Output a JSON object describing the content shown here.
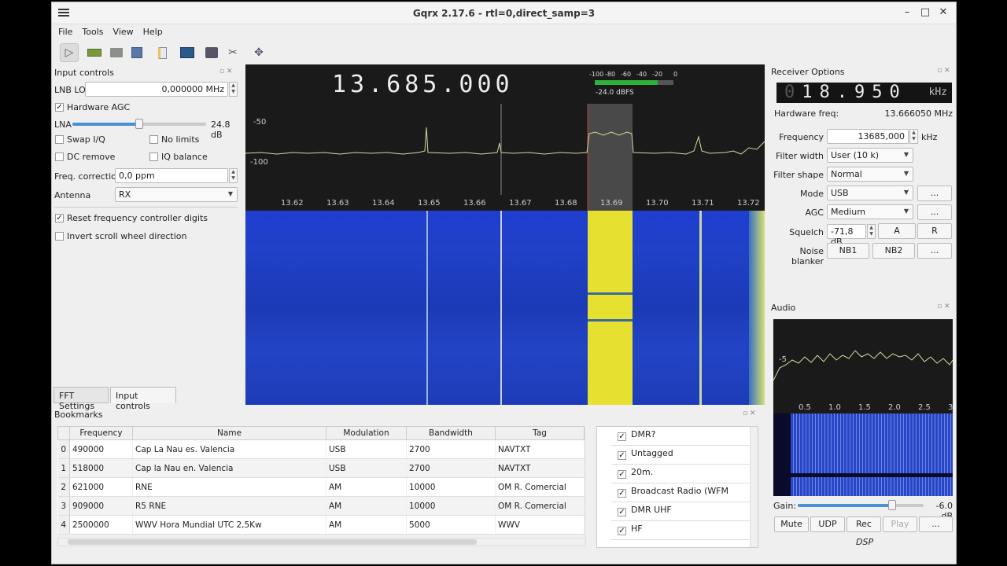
{
  "window": {
    "title": "Gqrx 2.17.6 - rtl=0,direct_samp=3",
    "minimize": "–",
    "maximize": "□",
    "close": "✕"
  },
  "menu": [
    "File",
    "Tools",
    "View",
    "Help"
  ],
  "toolbar": {
    "icons": [
      "play-icon",
      "hardware-icon",
      "open-icon",
      "save-icon",
      "document-icon",
      "spectrum-icon",
      "remote-icon",
      "tools-icon",
      "move-icon"
    ]
  },
  "input_controls": {
    "title": "Input controls",
    "lnb_lo_label": "LNB LO",
    "lnb_lo_value": "0,000000 MHz",
    "hardware_agc_label": "Hardware AGC",
    "lna_label": "LNA",
    "lna_value": "24.8 dB",
    "lna_level": 0.5,
    "swap_iq": "Swap I/Q",
    "no_limits": "No limits",
    "dc_remove": "DC remove",
    "iq_balance": "IQ balance",
    "freq_corr_label": "Freq. correction",
    "freq_corr_value": "0,0 ppm",
    "antenna_label": "Antenna",
    "antenna_value": "RX",
    "reset_digits": "Reset frequency controller digits",
    "invert_scroll": "Invert scroll wheel direction"
  },
  "left_tabs": [
    "FFT Settings",
    "Input controls"
  ],
  "display": {
    "frequency": "13.685.000",
    "meter_ticks": [
      "-100",
      "-80",
      "-60",
      "-40",
      "-20",
      "0"
    ],
    "meter_value": "-24.0 dBFS",
    "y_ticks": [
      "-50",
      "-100"
    ],
    "x_ticks": [
      "13.62",
      "13.63",
      "13.64",
      "13.65",
      "13.66",
      "13.67",
      "13.68",
      "13.69",
      "13.70",
      "13.71",
      "13.72"
    ]
  },
  "receiver": {
    "title": "Receiver Options",
    "lcd_dim": "0",
    "lcd_value": "18.950",
    "lcd_unit": "kHz",
    "hw_freq_label": "Hardware freq:",
    "hw_freq_value": "13.666050 MHz",
    "frequency_label": "Frequency",
    "frequency_value": "13685,000",
    "frequency_unit": "kHz",
    "filter_width_label": "Filter width",
    "filter_width_value": "User (10 k)",
    "filter_shape_label": "Filter shape",
    "filter_shape_value": "Normal",
    "mode_label": "Mode",
    "mode_value": "USB",
    "agc_label": "AGC",
    "agc_value": "Medium",
    "squelch_label": "Squelch",
    "squelch_value": "-71,8 dB",
    "squelch_a": "A",
    "squelch_r": "R",
    "nb_label": "Noise blanker",
    "nb1": "NB1",
    "nb2": "NB2",
    "more": "..."
  },
  "audio": {
    "title": "Audio",
    "y_tick": "-5",
    "x_ticks": [
      "0.5",
      "1.0",
      "1.5",
      "2.0",
      "2.5",
      "3"
    ],
    "gain_label": "Gain:",
    "gain_value": "-6.0 dB",
    "gain_level": 0.75,
    "mute": "Mute",
    "udp": "UDP",
    "rec": "Rec",
    "play": "Play",
    "more": "...",
    "dsp": "DSP"
  },
  "bookmarks": {
    "title": "Bookmarks",
    "columns": [
      "Frequency",
      "Name",
      "Modulation",
      "Bandwidth",
      "Tag"
    ],
    "rows": [
      {
        "idx": "0",
        "freq": "490000",
        "name": "Cap La Nau es. Valencia",
        "mod": "USB",
        "bw": "2700",
        "tag": "NAVTXT"
      },
      {
        "idx": "1",
        "freq": "518000",
        "name": "Cap la Nau en. Valencia",
        "mod": "USB",
        "bw": "2700",
        "tag": "NAVTXT"
      },
      {
        "idx": "2",
        "freq": "621000",
        "name": "RNE",
        "mod": "AM",
        "bw": "10000",
        "tag": "OM R. Comercial"
      },
      {
        "idx": "3",
        "freq": "909000",
        "name": "R5 RNE",
        "mod": "AM",
        "bw": "10000",
        "tag": "OM R. Comercial"
      },
      {
        "idx": "4",
        "freq": "2500000",
        "name": "WWV Hora Mundial UTC 2,5Kw",
        "mod": "AM",
        "bw": "5000",
        "tag": "WWV"
      }
    ],
    "tags": [
      "DMR?",
      "Untagged",
      "20m.",
      "Broadcast Radio (WFM",
      "DMR UHF",
      "HF"
    ]
  }
}
